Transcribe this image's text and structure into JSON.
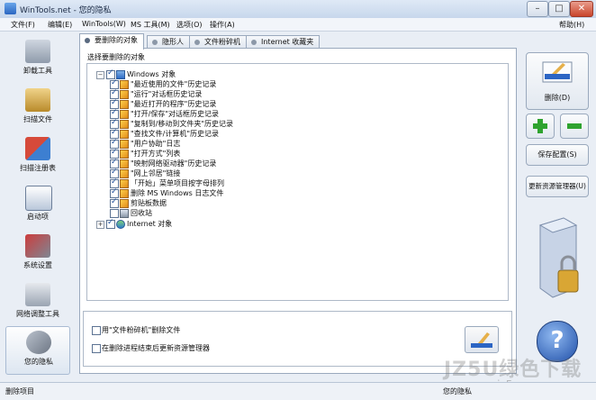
{
  "window": {
    "title": "WinTools.net - 您的隐私",
    "minimize": "–",
    "maximize": "□",
    "close": "✕"
  },
  "menu": {
    "items": [
      "文件(F)",
      "编辑(E)",
      "WinTools(W)",
      "MS 工具(M)",
      "选项(O)",
      "操作(A)"
    ],
    "help": "帮助(H)"
  },
  "sidebar": {
    "items": [
      {
        "label": "卸载工具",
        "icon": "uninstall-icon"
      },
      {
        "label": "扫描文件",
        "icon": "scan-files-icon"
      },
      {
        "label": "扫描注册表",
        "icon": "scan-registry-icon"
      },
      {
        "label": "启动项",
        "icon": "startup-icon"
      },
      {
        "label": "系统设置",
        "icon": "system-settings-icon"
      },
      {
        "label": "网络调整工具",
        "icon": "network-tweak-icon"
      },
      {
        "label": "您的隐私",
        "icon": "privacy-keys-icon"
      }
    ]
  },
  "tabs": [
    "要删除的对象",
    "隐形人",
    "文件粉碎机",
    "Internet 收藏夹"
  ],
  "main": {
    "group_label": "选择要删除的对象",
    "tree": {
      "root": "Windows 对象",
      "children": [
        "\"最近使用的文件\"历史记录",
        "\"运行\"对话框历史记录",
        "\"最近打开的程序\"历史记录",
        "\"打开/保存\"对话框历史记录",
        "\"复制到/移动到文件夹\"历史记录",
        "\"查找文件/计算机\"历史记录",
        "\"用户协助\"日志",
        "\"打开方式\"列表",
        "\"映射网络驱动器\"历史记录",
        "\"网上邻居\"链接",
        "「开始」菜单项目按字母排列",
        "删除 MS Windows 日志文件",
        "剪贴板数据",
        "回收站"
      ],
      "root2": "Internet 对象"
    },
    "options": [
      "用\"文件粉碎机\"删除文件",
      "在删除进程结束后更新资源管理器"
    ]
  },
  "right": {
    "delete_label": "删除(D)",
    "save_config": "保存配置(S)",
    "refresh_explorer": "更新资源管理器(U)",
    "help_icon": "?"
  },
  "status": {
    "left": "删除项目",
    "right": "您的隐私"
  },
  "watermark": {
    "main": "JZ5U绿色下载",
    "url": "www.jz5u.com"
  }
}
